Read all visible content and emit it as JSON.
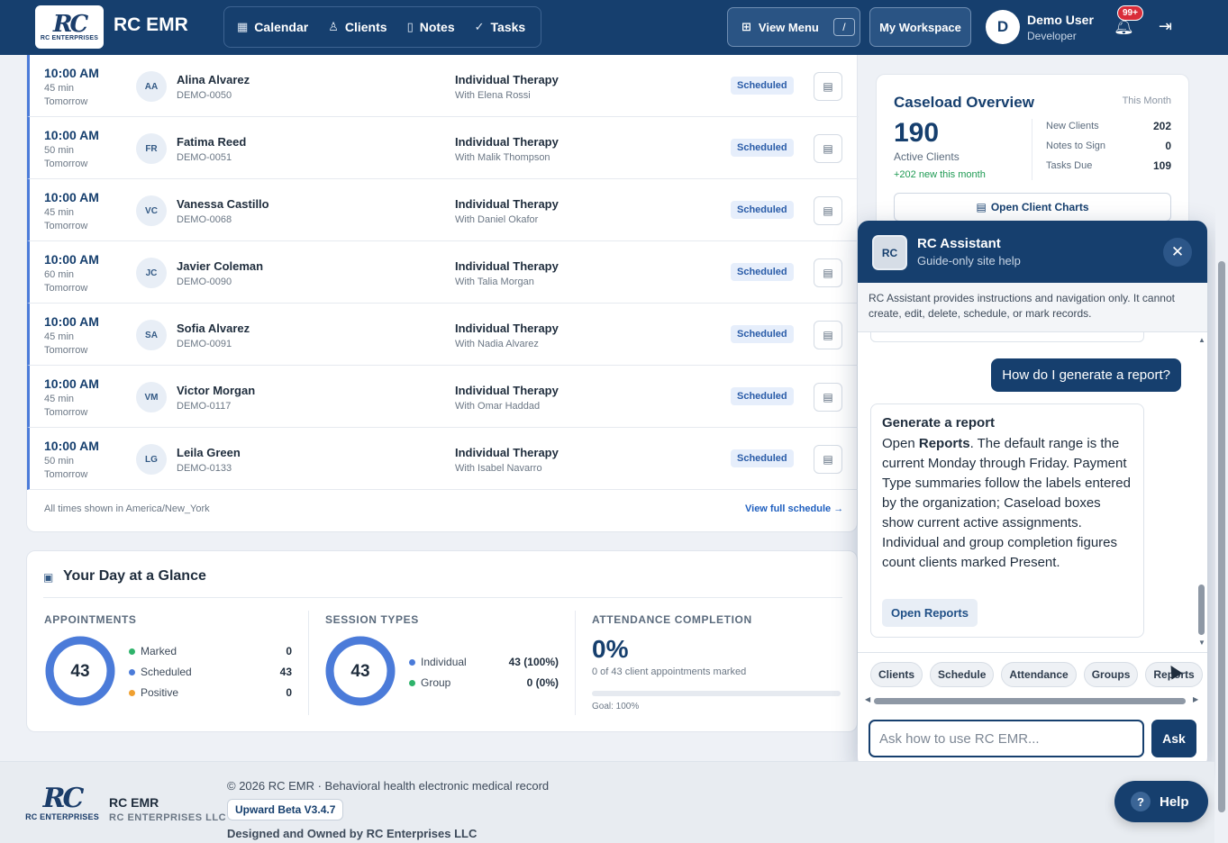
{
  "app": {
    "brand": "RC EMR",
    "logo_text": "RC ENTERPRISES",
    "logo_mark": "RC"
  },
  "nav": {
    "items": [
      {
        "label": "Calendar",
        "icon": "calendar-icon"
      },
      {
        "label": "Clients",
        "icon": "user-icon"
      },
      {
        "label": "Notes",
        "icon": "document-icon"
      },
      {
        "label": "Tasks",
        "icon": "check-circle-icon"
      }
    ],
    "view_menu": "View Menu",
    "view_menu_shortcut": "/",
    "workspace": "My Workspace"
  },
  "user": {
    "initial": "D",
    "name": "Demo User",
    "role": "Developer",
    "notifications": "99+"
  },
  "schedule": {
    "rows": [
      {
        "time": "10:00 AM",
        "duration": "45 min",
        "day": "Tomorrow",
        "initials": "AA",
        "name": "Alina Alvarez",
        "id": "DEMO-0050",
        "type": "Individual Therapy",
        "clinician": "With Elena Rossi",
        "status": "Scheduled"
      },
      {
        "time": "10:00 AM",
        "duration": "50 min",
        "day": "Tomorrow",
        "initials": "FR",
        "name": "Fatima Reed",
        "id": "DEMO-0051",
        "type": "Individual Therapy",
        "clinician": "With Malik Thompson",
        "status": "Scheduled"
      },
      {
        "time": "10:00 AM",
        "duration": "45 min",
        "day": "Tomorrow",
        "initials": "VC",
        "name": "Vanessa Castillo",
        "id": "DEMO-0068",
        "type": "Individual Therapy",
        "clinician": "With Daniel Okafor",
        "status": "Scheduled"
      },
      {
        "time": "10:00 AM",
        "duration": "60 min",
        "day": "Tomorrow",
        "initials": "JC",
        "name": "Javier Coleman",
        "id": "DEMO-0090",
        "type": "Individual Therapy",
        "clinician": "With Talia Morgan",
        "status": "Scheduled"
      },
      {
        "time": "10:00 AM",
        "duration": "45 min",
        "day": "Tomorrow",
        "initials": "SA",
        "name": "Sofia Alvarez",
        "id": "DEMO-0091",
        "type": "Individual Therapy",
        "clinician": "With Nadia Alvarez",
        "status": "Scheduled"
      },
      {
        "time": "10:00 AM",
        "duration": "45 min",
        "day": "Tomorrow",
        "initials": "VM",
        "name": "Victor Morgan",
        "id": "DEMO-0117",
        "type": "Individual Therapy",
        "clinician": "With Omar Haddad",
        "status": "Scheduled"
      },
      {
        "time": "10:00 AM",
        "duration": "50 min",
        "day": "Tomorrow",
        "initials": "LG",
        "name": "Leila Green",
        "id": "DEMO-0133",
        "type": "Individual Therapy",
        "clinician": "With Isabel Navarro",
        "status": "Scheduled"
      }
    ],
    "timezone_note": "All times shown in America/New_York",
    "full_schedule_link": "View full schedule →"
  },
  "glance": {
    "title": "Your Day at a Glance",
    "appointments": {
      "label": "APPOINTMENTS",
      "total": "43",
      "legend": [
        {
          "label": "Marked",
          "value": "0",
          "color": "#2fb36b"
        },
        {
          "label": "Scheduled",
          "value": "43",
          "color": "#4b7bd9"
        },
        {
          "label": "Positive",
          "value": "0",
          "color": "#f0a030"
        }
      ]
    },
    "session_types": {
      "label": "SESSION TYPES",
      "total": "43",
      "legend": [
        {
          "label": "Individual",
          "value": "43 (100%)",
          "color": "#4b7bd9"
        },
        {
          "label": "Group",
          "value": "0 (0%)",
          "color": "#2fb36b"
        }
      ]
    },
    "attendance": {
      "label": "ATTENDANCE COMPLETION",
      "percent": "0%",
      "fraction": 0,
      "subtext": "0 of 43 client appointments marked",
      "goal": "Goal: 100%"
    }
  },
  "caseload": {
    "title": "Caseload Overview",
    "period": "This Month",
    "active_count": "190",
    "active_label": "Active Clients",
    "new_this_month": "+202 new this month",
    "stats": [
      {
        "label": "New Clients",
        "value": "202"
      },
      {
        "label": "Notes to Sign",
        "value": "0"
      },
      {
        "label": "Tasks Due",
        "value": "109"
      }
    ],
    "button": "Open Client Charts"
  },
  "assistant": {
    "logo": "RC",
    "title": "RC Assistant",
    "subtitle": "Guide-only site help",
    "notice": "RC Assistant provides instructions and navigation only. It cannot create, edit, delete, schedule, or mark records.",
    "user_message": "How do I generate a report?",
    "reply_title": "Generate a report",
    "reply_part1": "Open ",
    "reply_bold": "Reports",
    "reply_part2": ". The default range is the current Monday through Friday. Payment Type summaries follow the labels entered by the organization; Caseload boxes show current active assignments. Individual and group completion figures count clients marked Present.",
    "reply_button": "Open Reports",
    "chips": [
      "Clients",
      "Schedule",
      "Attendance",
      "Groups",
      "Reports"
    ],
    "input_placeholder": "Ask how to use RC EMR...",
    "ask_button": "Ask"
  },
  "footer": {
    "brand": "RC EMR",
    "company": "RC ENTERPRISES LLC",
    "copyright": "© 2026 RC EMR · Behavioral health electronic medical record",
    "version": "Upward Beta V3.4.7",
    "designed_by": "Designed and Owned by RC Enterprises LLC"
  },
  "help_button": "Help",
  "colors": {
    "brand_navy": "#163f6e",
    "accent_blue": "#4b7bd9",
    "success_green": "#2fb36b"
  }
}
